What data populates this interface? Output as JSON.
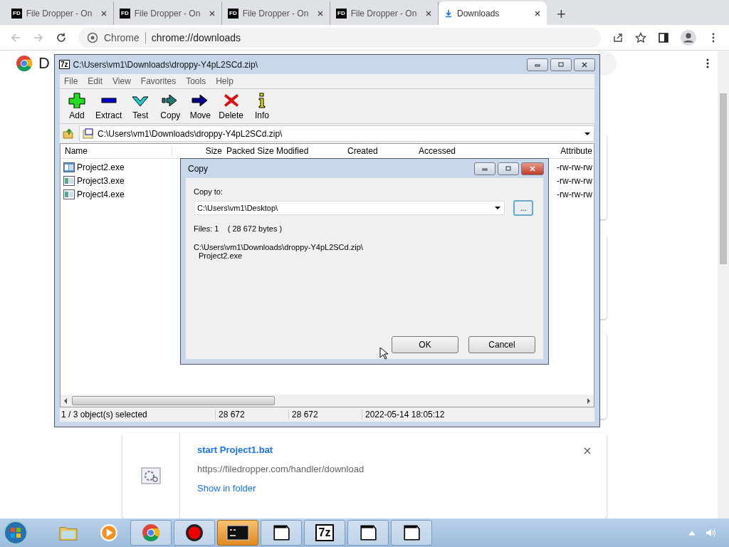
{
  "browser": {
    "tabs": [
      {
        "kind": "site",
        "badge": "FD",
        "label": "File Dropper - On",
        "selected": false
      },
      {
        "kind": "site",
        "badge": "FD",
        "label": "File Dropper - On",
        "selected": false
      },
      {
        "kind": "site",
        "badge": "FD",
        "label": "File Dropper - On",
        "selected": false
      },
      {
        "kind": "site",
        "badge": "FD",
        "label": "File Dropper - On",
        "selected": false
      },
      {
        "kind": "download",
        "label": "Downloads",
        "selected": true
      }
    ],
    "new_tab": "+",
    "omnibox": {
      "site": "Chrome",
      "url": "chrome://downloads"
    }
  },
  "downloads_page": {
    "heading": "D",
    "cards": [
      {
        "kind": "hidden"
      },
      {
        "kind": "hidden"
      },
      {
        "kind": "hidden"
      },
      {
        "kind": "file",
        "name": "start Project1.bat",
        "url": "https://filedropper.com/handler/download",
        "action": "Show in folder"
      }
    ]
  },
  "archive_window": {
    "icon_text": "7z",
    "title": "C:\\Users\\vm1\\Downloads\\droppy-Y4pL2SCd.zip\\",
    "menu": [
      "File",
      "Edit",
      "View",
      "Favorites",
      "Tools",
      "Help"
    ],
    "toolbar": [
      {
        "kind": "add",
        "label": "Add"
      },
      {
        "kind": "extract",
        "label": "Extract"
      },
      {
        "kind": "test",
        "label": "Test"
      },
      {
        "kind": "copy",
        "label": "Copy"
      },
      {
        "kind": "move",
        "label": "Move"
      },
      {
        "kind": "delete",
        "label": "Delete"
      },
      {
        "kind": "info",
        "label": "Info"
      }
    ],
    "path": "C:\\Users\\vm1\\Downloads\\droppy-Y4pL2SCd.zip\\",
    "columns": [
      "Name",
      "Size",
      "Packed Size",
      "Modified",
      "Created",
      "Accessed",
      "Attribute"
    ],
    "rows": [
      {
        "name": "Project2.exe",
        "attributes": "-rw-rw-rw",
        "selected": true
      },
      {
        "name": "Project3.exe",
        "attributes": "-rw-rw-rw",
        "selected": false
      },
      {
        "name": "Project4.exe",
        "attributes": "-rw-rw-rw",
        "selected": false
      }
    ],
    "status_bar": [
      "1 / 3 object(s) selected",
      "28 672",
      "28 672",
      "2022-05-14 18:05:12"
    ]
  },
  "copy_dialog": {
    "title": "Copy",
    "copy_to_label": "Copy to:",
    "destination": "C:\\Users\\vm1\\Desktop\\",
    "browse": "...",
    "files_info": "Files: 1    ( 28 672 bytes )",
    "source_path": "C:\\Users\\vm1\\Downloads\\droppy-Y4pL2SCd.zip\\",
    "source_file": "Project2.exe",
    "buttons": [
      "OK",
      "Cancel"
    ]
  },
  "taskbar": {
    "items": [
      {
        "kind": "explorer",
        "selected": false
      },
      {
        "kind": "media",
        "selected": false
      },
      {
        "kind": "chrome",
        "selected": false
      },
      {
        "kind": "record",
        "selected": false
      },
      {
        "kind": "console",
        "selected": true
      },
      {
        "kind": "window",
        "selected": false
      },
      {
        "kind": "sevenzip",
        "text": "7z",
        "selected": false
      },
      {
        "kind": "window",
        "selected": false
      },
      {
        "kind": "window",
        "selected": false
      }
    ]
  }
}
